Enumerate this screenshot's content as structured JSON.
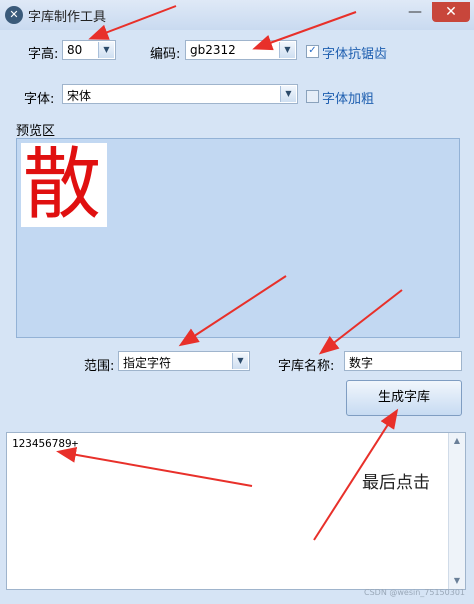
{
  "window": {
    "title": "字库制作工具",
    "minimize": "—",
    "close": "✕"
  },
  "font_size": {
    "label": "字高:",
    "value": "80"
  },
  "encoding": {
    "label": "编码:",
    "value": "gb2312"
  },
  "antialias": {
    "label": "字体抗锯齿",
    "checked": true
  },
  "font": {
    "label": "字体:",
    "value": "宋体"
  },
  "bold": {
    "label": "字体加粗",
    "checked": false
  },
  "preview": {
    "label": "预览区",
    "glyph": "散"
  },
  "range": {
    "label": "范围:",
    "value": "指定字符"
  },
  "lib_name": {
    "label": "字库名称:",
    "value": "数字"
  },
  "generate_button": "生成字库",
  "output": {
    "text": "123456789+"
  },
  "annotation": "最后点击",
  "watermark": "CSDN @wesin_75150301",
  "colors": {
    "arrow": "#e8302a",
    "glyph": "#e01010"
  }
}
